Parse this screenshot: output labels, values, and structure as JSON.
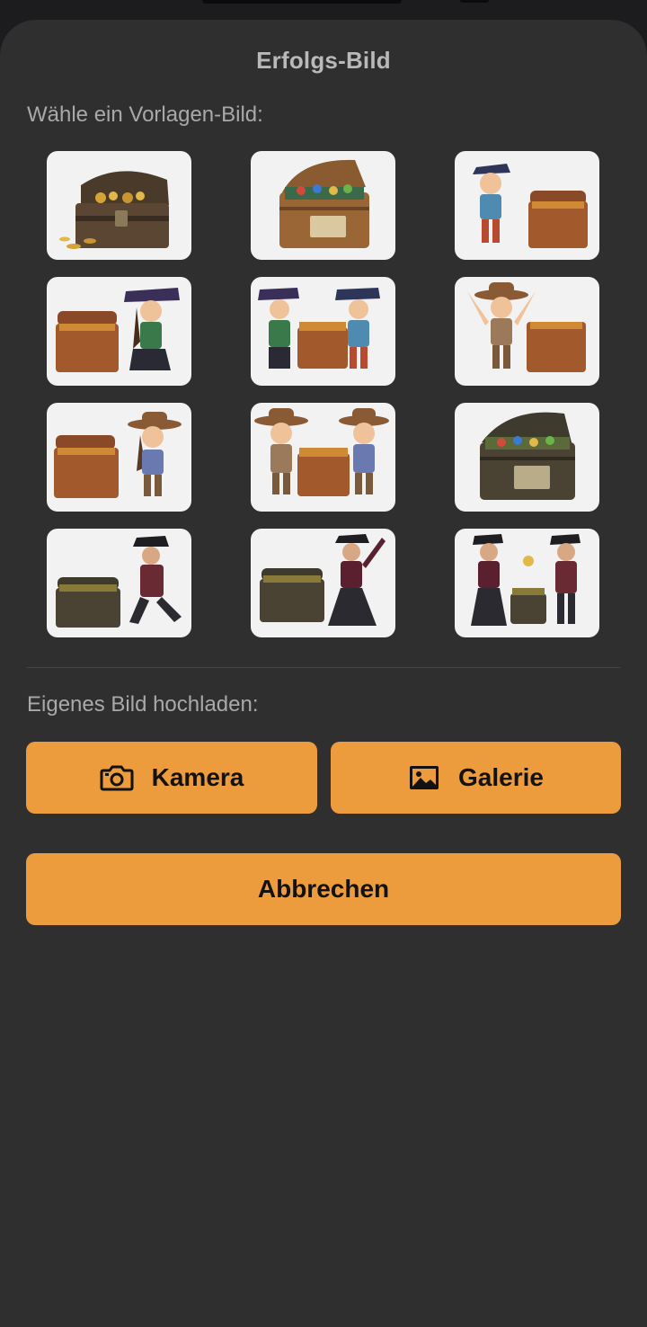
{
  "dialog": {
    "title": "Erfolgs-Bild",
    "template_label": "Wähle ein Vorlagen-Bild:",
    "upload_label": "Eigenes Bild hochladen:",
    "camera_label": "Kamera",
    "gallery_label": "Galerie",
    "cancel_label": "Abbrechen"
  },
  "icons": {
    "camera": "camera-icon",
    "gallery": "image-icon"
  },
  "colors": {
    "sheet_background": "#2f2f2f",
    "accent": "#ec9c3c",
    "tile_background": "#f2f2f2"
  }
}
